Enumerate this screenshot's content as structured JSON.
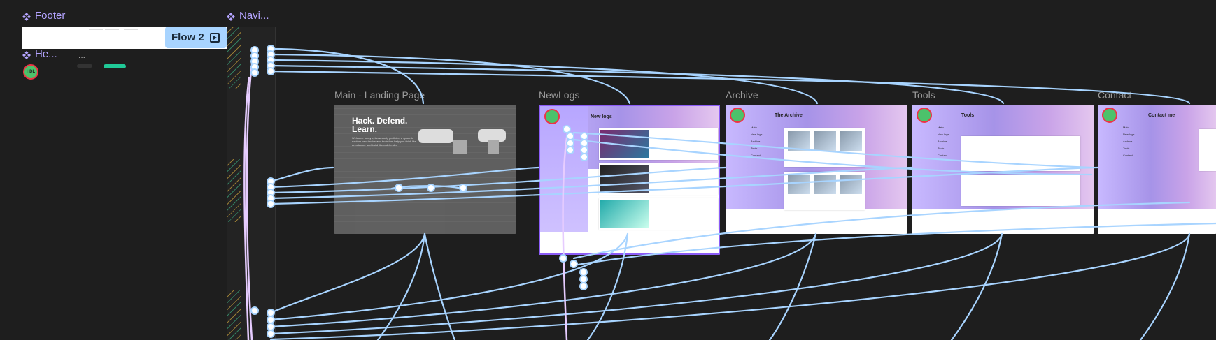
{
  "components": {
    "footer_label": "Footer",
    "navi_label": "Navi...",
    "header_label": "He...",
    "ellipsis": "..."
  },
  "flow": {
    "label": "Flow 2"
  },
  "frames": {
    "landing": {
      "label": "Main - Landing Page",
      "title": "Hack. Defend. Learn.",
      "body": "Welcome to my cybersecurity portfolio, a space to explore new tactics and tools that help you think like an attacker and build like a defender."
    },
    "newlogs": {
      "label": "NewLogs",
      "title": "New logs"
    },
    "archive": {
      "label": "Archive",
      "title": "The Archive"
    },
    "tools": {
      "label": "Tools",
      "title": "Tools"
    },
    "contact": {
      "label": "Contact",
      "title": "Contact me"
    }
  },
  "site": {
    "brand": "Hack. Defend. Learn.",
    "logo_text": "HDL",
    "nav": [
      "Main",
      "New logs",
      "Archive",
      "Tools",
      "Contact"
    ]
  },
  "colors": {
    "background": "#1e1e1e",
    "component_label": "#b4a4ff",
    "flow_line": "#a8d4ff",
    "nav_line": "#e6ccff"
  }
}
